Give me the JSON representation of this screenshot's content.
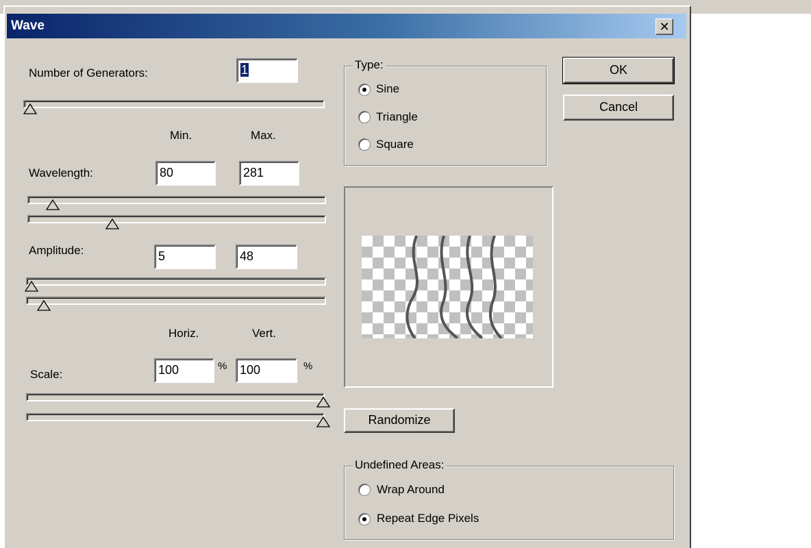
{
  "dialog": {
    "title": "Wave",
    "close_label": "✕"
  },
  "generators": {
    "label": "Number of Generators:",
    "value": "1",
    "slider_level": 0.0
  },
  "headers": {
    "min": "Min.",
    "max": "Max.",
    "horiz": "Horiz.",
    "vert": "Vert.",
    "percent": "%"
  },
  "wavelength": {
    "label": "Wavelength:",
    "min": "80",
    "max": "281"
  },
  "amplitude": {
    "label": "Amplitude:",
    "min": "5",
    "max": "48"
  },
  "scale": {
    "label": "Scale:",
    "horiz": "100",
    "vert": "100"
  },
  "type_group": {
    "legend": "Type:",
    "options": [
      {
        "label": "Sine",
        "selected": true
      },
      {
        "label": "Triangle",
        "selected": false
      },
      {
        "label": "Square",
        "selected": false
      }
    ]
  },
  "buttons": {
    "ok": "OK",
    "cancel": "Cancel",
    "randomize": "Randomize"
  },
  "undefined_group": {
    "legend": "Undefined Areas:",
    "options": [
      {
        "label": "Wrap Around",
        "selected": false
      },
      {
        "label": "Repeat Edge Pixels",
        "selected": true
      }
    ]
  }
}
